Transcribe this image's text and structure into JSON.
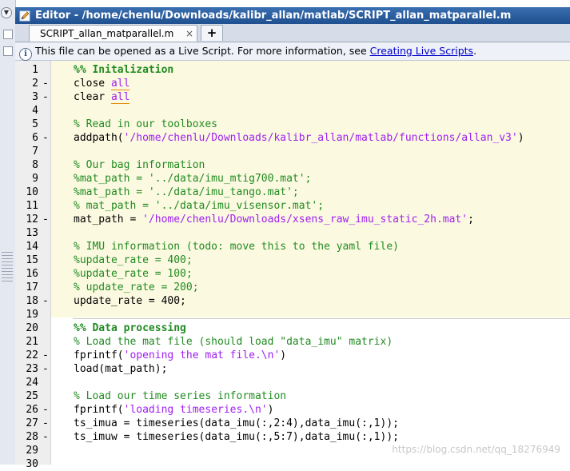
{
  "window": {
    "title": "Editor - /home/chenlu/Downloads/kalibr_allan/matlab/SCRIPT_allan_matparallel.m"
  },
  "tabs": [
    {
      "label": "SCRIPT_allan_matparallel.m",
      "close": "×"
    }
  ],
  "tab_add_label": "+",
  "infobar": {
    "text": "This file can be opened as a Live Script. For more information, see ",
    "link": "Creating Live Scripts",
    "end": "."
  },
  "code_lines": [
    {
      "n": "1",
      "bp": "",
      "segs": [
        {
          "t": "%% Initalization",
          "k": "cell"
        }
      ]
    },
    {
      "n": "2",
      "bp": "-",
      "segs": [
        {
          "t": "close ",
          "k": "plain"
        },
        {
          "t": "all",
          "k": "string"
        }
      ]
    },
    {
      "n": "3",
      "bp": "-",
      "segs": [
        {
          "t": "clear ",
          "k": "plain"
        },
        {
          "t": "all",
          "k": "string"
        }
      ]
    },
    {
      "n": "4",
      "bp": "",
      "segs": []
    },
    {
      "n": "5",
      "bp": "",
      "segs": [
        {
          "t": "% Read in our toolboxes",
          "k": "comment"
        }
      ]
    },
    {
      "n": "6",
      "bp": "-",
      "segs": [
        {
          "t": "addpath(",
          "k": "plain"
        },
        {
          "t": "'/home/chenlu/Downloads/kalibr_allan/matlab/functions/allan_v3'",
          "k": "string"
        },
        {
          "t": ")",
          "k": "plain"
        }
      ]
    },
    {
      "n": "7",
      "bp": "",
      "segs": []
    },
    {
      "n": "8",
      "bp": "",
      "segs": [
        {
          "t": "% Our bag information",
          "k": "comment"
        }
      ]
    },
    {
      "n": "9",
      "bp": "",
      "segs": [
        {
          "t": "%mat_path = '../data/imu_mtig700.mat';",
          "k": "comment"
        }
      ]
    },
    {
      "n": "10",
      "bp": "",
      "segs": [
        {
          "t": "%mat_path = '../data/imu_tango.mat';",
          "k": "comment"
        }
      ]
    },
    {
      "n": "11",
      "bp": "",
      "segs": [
        {
          "t": "% mat_path = '../data/imu_visensor.mat';",
          "k": "comment"
        }
      ]
    },
    {
      "n": "12",
      "bp": "-",
      "segs": [
        {
          "t": "mat_path = ",
          "k": "plain"
        },
        {
          "t": "'/home/chenlu/Downloads/xsens_raw_imu_static_2h.mat'",
          "k": "string"
        },
        {
          "t": ";",
          "k": "plain"
        }
      ]
    },
    {
      "n": "13",
      "bp": "",
      "segs": []
    },
    {
      "n": "14",
      "bp": "",
      "segs": [
        {
          "t": "% IMU information (todo: move this to the yaml file)",
          "k": "comment"
        }
      ]
    },
    {
      "n": "15",
      "bp": "",
      "segs": [
        {
          "t": "%update_rate = 400;",
          "k": "comment"
        }
      ]
    },
    {
      "n": "16",
      "bp": "",
      "segs": [
        {
          "t": "%update_rate = 100;",
          "k": "comment"
        }
      ]
    },
    {
      "n": "17",
      "bp": "",
      "segs": [
        {
          "t": "% update_rate = 200;",
          "k": "comment"
        }
      ]
    },
    {
      "n": "18",
      "bp": "-",
      "segs": [
        {
          "t": "update_rate = 400;",
          "k": "plain"
        }
      ]
    },
    {
      "n": "19",
      "bp": "",
      "segs": []
    },
    {
      "n": "20",
      "bp": "",
      "segs": [
        {
          "t": "%% Data processing",
          "k": "cell"
        }
      ]
    },
    {
      "n": "21",
      "bp": "",
      "segs": [
        {
          "t": "% Load the mat file (should load \"data_imu\" matrix)",
          "k": "comment"
        }
      ]
    },
    {
      "n": "22",
      "bp": "-",
      "segs": [
        {
          "t": "fprintf(",
          "k": "plain"
        },
        {
          "t": "'opening the mat file.\\n'",
          "k": "string"
        },
        {
          "t": ")",
          "k": "plain"
        }
      ]
    },
    {
      "n": "23",
      "bp": "-",
      "segs": [
        {
          "t": "load(mat_path);",
          "k": "plain"
        }
      ]
    },
    {
      "n": "24",
      "bp": "",
      "segs": []
    },
    {
      "n": "25",
      "bp": "",
      "segs": [
        {
          "t": "% Load our time series information",
          "k": "comment"
        }
      ]
    },
    {
      "n": "26",
      "bp": "-",
      "segs": [
        {
          "t": "fprintf(",
          "k": "plain"
        },
        {
          "t": "'loading timeseries.\\n'",
          "k": "string"
        },
        {
          "t": ")",
          "k": "plain"
        }
      ]
    },
    {
      "n": "27",
      "bp": "-",
      "segs": [
        {
          "t": "ts_imua = timeseries(data_imu(:,2:4),data_imu(:,1));",
          "k": "plain"
        }
      ]
    },
    {
      "n": "28",
      "bp": "-",
      "segs": [
        {
          "t": "ts_imuw = timeseries(data_imu(:,5:7),data_imu(:,1));",
          "k": "plain"
        }
      ]
    },
    {
      "n": "29",
      "bp": "",
      "segs": []
    },
    {
      "n": "30",
      "bp": "",
      "segs": []
    }
  ],
  "watermark": "https://blog.csdn.net/qq_18276949"
}
